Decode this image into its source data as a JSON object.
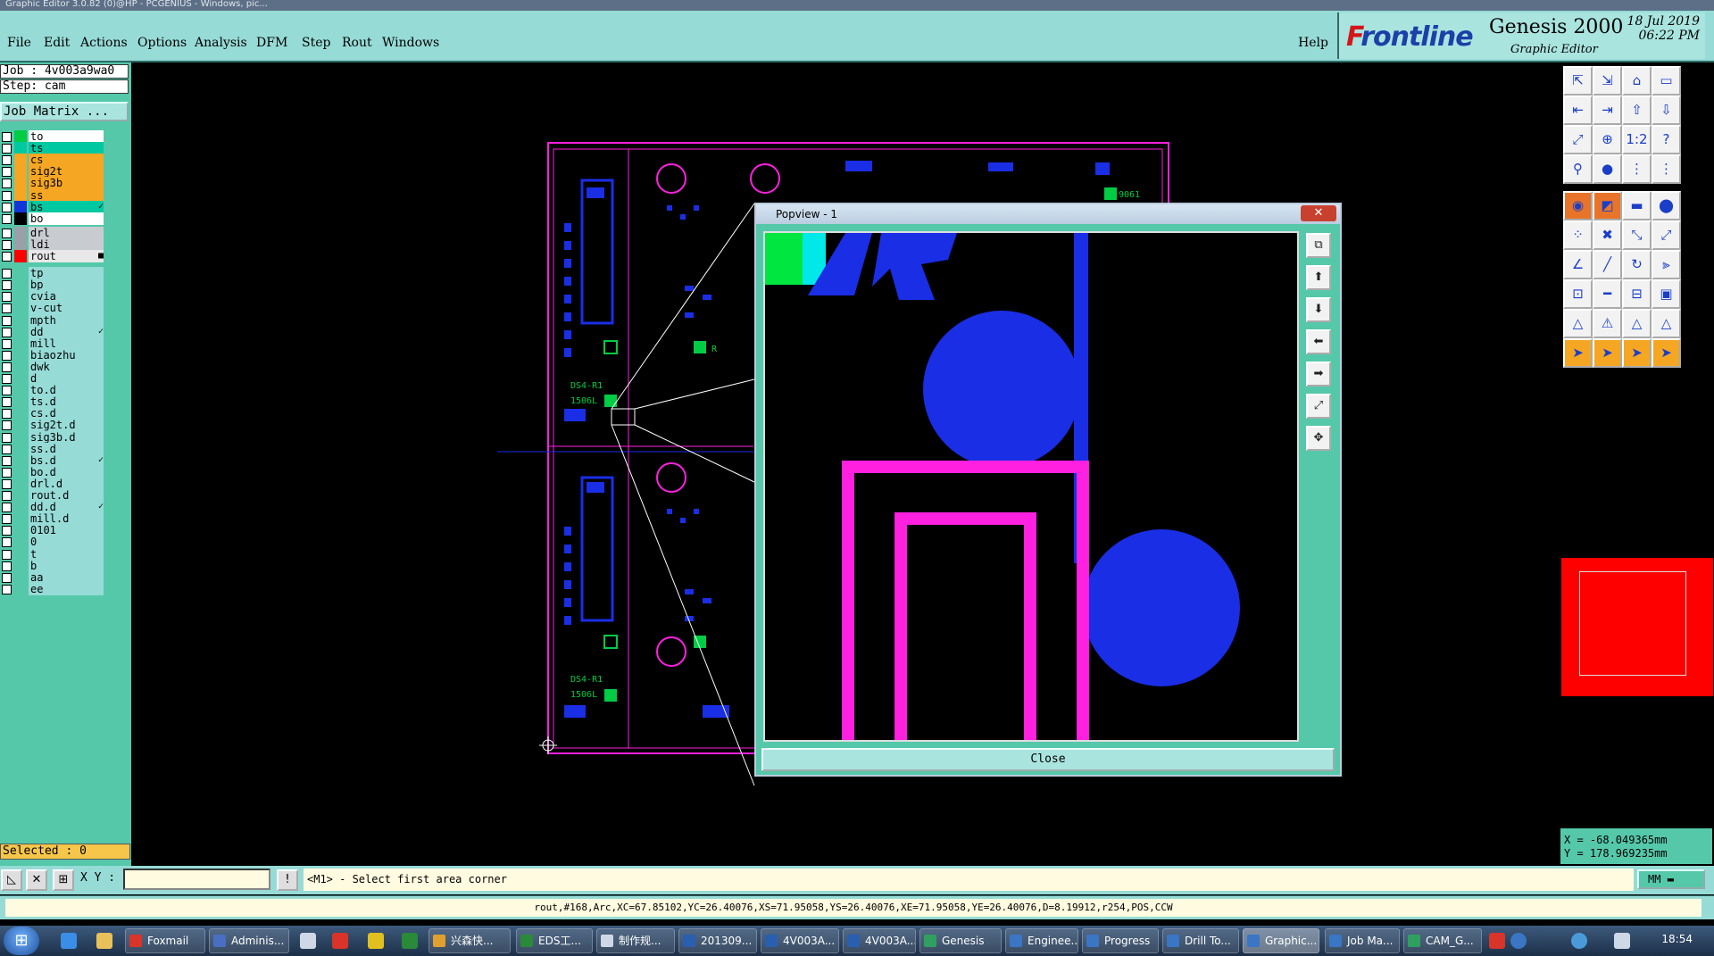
{
  "window_title": "Graphic Editor 3.0.82 (0)@HP - PCGENIUS - Windows, pic...",
  "menu": [
    "File",
    "Edit",
    "Actions",
    "Options",
    "Analysis",
    "DFM",
    "Step",
    "Rout",
    "Windows"
  ],
  "help_label": "Help",
  "brand": {
    "logo_first": "F",
    "logo_rest": "rontline",
    "product": "Genesis 2000",
    "subtitle": "Graphic Editor",
    "date": "18 Jul 2019",
    "time": "06:22 PM"
  },
  "job": {
    "job_label": "Job : 4v003a9wa0",
    "step_label": "Step: cam",
    "matrix_button": "Job Matrix ..."
  },
  "layers": [
    {
      "name": "to",
      "color": "#00cc44",
      "bg": "#ffffff",
      "mark": ""
    },
    {
      "name": "ts",
      "color": "#00c8a0",
      "bg": "#00c8a0",
      "mark": ""
    },
    {
      "name": "cs",
      "color": "#f5a623",
      "bg": "#f5a623",
      "mark": ""
    },
    {
      "name": "sig2t",
      "color": "#f5a623",
      "bg": "#f5a623",
      "mark": ""
    },
    {
      "name": "sig3b",
      "color": "#f5a623",
      "bg": "#f5a623",
      "mark": ""
    },
    {
      "name": "ss",
      "color": "#f5a623",
      "bg": "#f5a623",
      "mark": ""
    },
    {
      "name": "bs",
      "color": "#1435d6",
      "bg": "#00c8a0",
      "mark": "✓"
    },
    {
      "name": "bo",
      "color": "#000000",
      "bg": "#ffffff",
      "mark": ""
    },
    {
      "name": "drl",
      "color": "#9aa0a8",
      "bg": "#c8ccd0",
      "mark": ""
    },
    {
      "name": "ldi",
      "color": "#9aa0a8",
      "bg": "#c8ccd0",
      "mark": ""
    },
    {
      "name": "rout",
      "color": "#ff0000",
      "bg": "#e8e8e8",
      "mark": "■"
    },
    {
      "name": "tp",
      "color": "",
      "bg": "#96dbd6",
      "mark": ""
    },
    {
      "name": "bp",
      "color": "",
      "bg": "#96dbd6",
      "mark": ""
    },
    {
      "name": "cvia",
      "color": "",
      "bg": "#96dbd6",
      "mark": ""
    },
    {
      "name": "v-cut",
      "color": "",
      "bg": "#96dbd6",
      "mark": ""
    },
    {
      "name": "mpth",
      "color": "",
      "bg": "#96dbd6",
      "mark": ""
    },
    {
      "name": "dd",
      "color": "",
      "bg": "#96dbd6",
      "mark": "✓"
    },
    {
      "name": "mill",
      "color": "",
      "bg": "#96dbd6",
      "mark": ""
    },
    {
      "name": "biaozhu",
      "color": "",
      "bg": "#96dbd6",
      "mark": ""
    },
    {
      "name": "dwk",
      "color": "",
      "bg": "#96dbd6",
      "mark": ""
    },
    {
      "name": "d",
      "color": "",
      "bg": "#96dbd6",
      "mark": ""
    },
    {
      "name": "to.d",
      "color": "",
      "bg": "#96dbd6",
      "mark": ""
    },
    {
      "name": "ts.d",
      "color": "",
      "bg": "#96dbd6",
      "mark": ""
    },
    {
      "name": "cs.d",
      "color": "",
      "bg": "#96dbd6",
      "mark": ""
    },
    {
      "name": "sig2t.d",
      "color": "",
      "bg": "#96dbd6",
      "mark": ""
    },
    {
      "name": "sig3b.d",
      "color": "",
      "bg": "#96dbd6",
      "mark": ""
    },
    {
      "name": "ss.d",
      "color": "",
      "bg": "#96dbd6",
      "mark": ""
    },
    {
      "name": "bs.d",
      "color": "",
      "bg": "#96dbd6",
      "mark": "✓"
    },
    {
      "name": "bo.d",
      "color": "",
      "bg": "#96dbd6",
      "mark": ""
    },
    {
      "name": "drl.d",
      "color": "",
      "bg": "#96dbd6",
      "mark": ""
    },
    {
      "name": "rout.d",
      "color": "",
      "bg": "#96dbd6",
      "mark": ""
    },
    {
      "name": "dd.d",
      "color": "",
      "bg": "#96dbd6",
      "mark": "✓"
    },
    {
      "name": "mill.d",
      "color": "",
      "bg": "#96dbd6",
      "mark": ""
    },
    {
      "name": "0101",
      "color": "",
      "bg": "#96dbd6",
      "mark": ""
    },
    {
      "name": "0",
      "color": "",
      "bg": "#96dbd6",
      "mark": ""
    },
    {
      "name": "t",
      "color": "",
      "bg": "#96dbd6",
      "mark": ""
    },
    {
      "name": "b",
      "color": "",
      "bg": "#96dbd6",
      "mark": ""
    },
    {
      "name": "aa",
      "color": "",
      "bg": "#96dbd6",
      "mark": ""
    },
    {
      "name": "ee",
      "color": "",
      "bg": "#96dbd6",
      "mark": ""
    }
  ],
  "selected_label": "Selected : 0",
  "board_labels": [
    "9061",
    "R",
    "DS4-R1",
    "1506L",
    "DS4-R1",
    "1506L"
  ],
  "popview": {
    "title": "Popview - 1",
    "close_x": "✕",
    "close_button": "Close",
    "tools": [
      "⧉",
      "⬆",
      "⬇",
      "⬅",
      "➡",
      "⤢",
      "✥"
    ]
  },
  "coords": {
    "x": "X = -68.049365mm",
    "y": "Y = 178.969235mm"
  },
  "statusbar": {
    "xy_label": "X Y :",
    "xy_value": "",
    "info_icon": "!",
    "prompt": "<M1> - Select first area corner",
    "units": "MM"
  },
  "feature_info": "rout,#168,Arc,XC=67.85102,YC=26.40076,XS=71.95058,YS=26.40076,XE=71.95058,YE=26.40076,D=8.19912,r254,POS,CCW",
  "taskbar": {
    "start": "⊞",
    "items": [
      {
        "label": "Foxmail",
        "icon_color": "#d8342a"
      },
      {
        "label": "Adminis...",
        "icon_color": "#4a6fc2"
      },
      {
        "label": "兴森快...",
        "icon_color": "#e0a030"
      },
      {
        "label": "EDS工...",
        "icon_color": "#2a8a3a"
      },
      {
        "label": "制作规...",
        "icon_color": "#cfd8e6"
      },
      {
        "label": "201309...",
        "icon_color": "#2a5fb0"
      },
      {
        "label": "4V003A...",
        "icon_color": "#2a5fb0"
      },
      {
        "label": "4V003A...",
        "icon_color": "#2a5fb0"
      },
      {
        "label": "Genesis",
        "icon_color": "#30a060"
      },
      {
        "label": "Enginee...",
        "icon_color": "#3a76c4"
      },
      {
        "label": "Progress",
        "icon_color": "#3a76c4"
      },
      {
        "label": "Drill To...",
        "icon_color": "#3a76c4"
      },
      {
        "label": "Graphic...",
        "icon_color": "#3a76c4"
      },
      {
        "label": "Job Ma...",
        "icon_color": "#3a76c4"
      },
      {
        "label": "CAM_G...",
        "icon_color": "#30a060"
      }
    ],
    "clock": "18:54"
  },
  "colors": {
    "accent_teal": "#96dbd6",
    "panel_green": "#55c8aa",
    "pcb_blue": "#1a2ee6",
    "rout_magenta": "#ff20e0",
    "overview_red": "#ff0000"
  },
  "toolbar_icons": [
    "zoom-home",
    "zoom-in",
    "zoom-out",
    "zoom-fit",
    "pan-left",
    "pan-right",
    "pan-up",
    "pan-down",
    "fit",
    "center",
    "one-to-one",
    "help",
    "measure",
    "snap",
    "connect",
    "net",
    "pad",
    "contour",
    "line",
    "fill",
    "node",
    "cross",
    "link",
    "arc",
    "angle",
    "line-draw",
    "rotate",
    "mirror",
    "pad-add",
    "line-add",
    "box",
    "shapes",
    "triangle",
    "triangle-2",
    "arc-2",
    "triangle-3",
    "pointer",
    "pointer-2",
    "pointer-3",
    "pointer-4"
  ]
}
